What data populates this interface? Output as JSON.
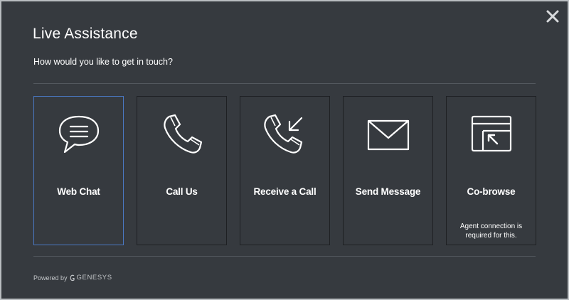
{
  "dialog": {
    "title": "Live Assistance",
    "subtitle": "How would you like to get in touch?",
    "close_icon": "close-icon"
  },
  "options": [
    {
      "label": "Web Chat",
      "icon": "chat-bubble-icon",
      "selected": true
    },
    {
      "label": "Call Us",
      "icon": "phone-icon"
    },
    {
      "label": "Receive a Call",
      "icon": "phone-incoming-icon"
    },
    {
      "label": "Send Message",
      "icon": "envelope-icon"
    },
    {
      "label": "Co-browse",
      "icon": "browser-window-arrow-icon",
      "note": "Agent connection is required for this."
    }
  ],
  "footer": {
    "powered_by": "Powered by",
    "brand": "GENESYS",
    "brand_icon": "genesys-logo-icon"
  },
  "colors": {
    "background": "#363a3f",
    "selected_border": "#4a78c2",
    "text": "#ffffff"
  }
}
